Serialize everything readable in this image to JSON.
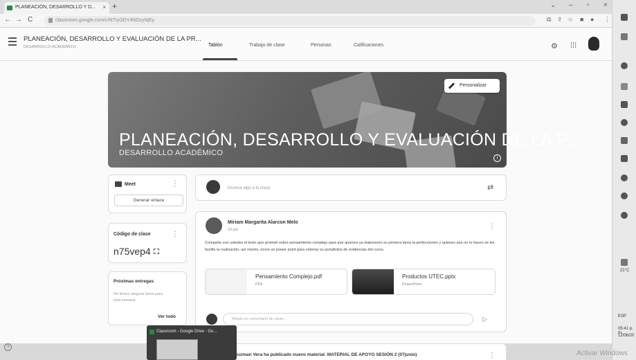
{
  "browser": {
    "tab_title": "PLANEACIÓN, DESARROLLO Y D...",
    "new_tab": "+",
    "url": "classroom.google.com/c/NTIyODY4NDcyNjEy"
  },
  "header": {
    "class_title": "PLANEACIÓN, DESARROLLO Y EVALUACIÓN DE LA PR...",
    "class_subtitle": "DESARROLLO ACADÉMICO",
    "tabs": [
      {
        "label": "Tablón",
        "active": true
      },
      {
        "label": "Trabajo de clase",
        "active": false
      },
      {
        "label": "Personas",
        "active": false
      },
      {
        "label": "Calificaciones",
        "active": false
      }
    ]
  },
  "banner": {
    "title": "PLANEACIÓN, DESARROLLO Y EVALUACIÓN DE LA P...",
    "subtitle": "DESARROLLO ACADÉMICO",
    "customize_label": "Personalizar",
    "info_glyph": "i"
  },
  "meet": {
    "title": "Meet",
    "button": "Generar enlace"
  },
  "class_code": {
    "label": "Código de clase",
    "value": "n75vep4"
  },
  "upcoming": {
    "title": "Próximas entregas",
    "text": "No tienes ninguna tarea para esta semana",
    "see_all": "Ver todo"
  },
  "announce": {
    "placeholder": "Anuncia algo a tu clase"
  },
  "post": {
    "author": "Miriam Margarita Alarcon Melo",
    "date": "10 jun",
    "text": "Comparto con ustedes el texto que prometí sobre pensamiento complejo para que quienes ya elaboraron su primera tarea la perfeccionen y quienes aún no lo hacen se les facilite la realización, así mismo, envío un power point para ordenar su portafolios de evidencias del curso.",
    "attachments": [
      {
        "name": "Pensamiento Complejo.pdf",
        "type": "PDF"
      },
      {
        "name": "Productos UTEC.pptx",
        "type": "PowerPoint"
      }
    ],
    "comment_placeholder": "Añade un comentario de clase..."
  },
  "post2": {
    "text": "Guzman Vera ha publicado nuevo material: MATERIAL DE APOYO SESIÓN 2 (07junio)"
  },
  "taskbar_preview": {
    "title": "Classroom - Google Drive - Go..."
  },
  "system": {
    "weather": "21°C",
    "lang": "ESP",
    "time": "05:41 p. m.",
    "date": "12/06/20",
    "watermark": "Activar Windows"
  },
  "icons": [
    "menu-icon",
    "settings-icon",
    "apps-grid-icon",
    "pencil-icon",
    "info-icon",
    "video-camera-icon",
    "fullscreen-icon",
    "repost-icon",
    "send-icon",
    "help-icon",
    "kebab-icon",
    "back-icon",
    "forward-icon",
    "reload-icon",
    "lock-icon",
    "star-icon"
  ]
}
